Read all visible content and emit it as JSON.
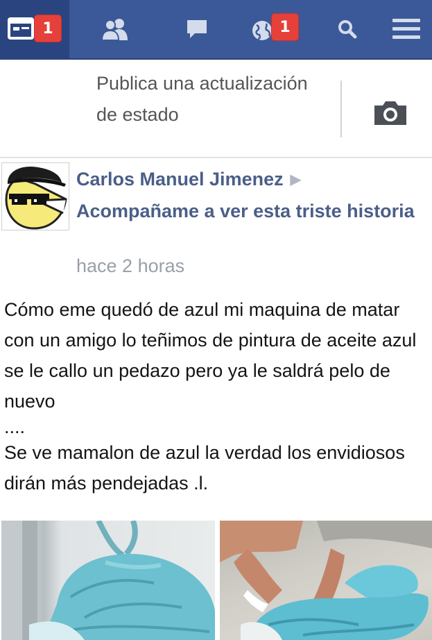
{
  "nav": {
    "feed_badge": "1",
    "globe_badge": "1",
    "items": [
      {
        "icon": "news-feed-icon"
      },
      {
        "icon": "friends-icon"
      },
      {
        "icon": "messages-icon"
      },
      {
        "icon": "notifications-globe-icon"
      },
      {
        "icon": "search-icon"
      },
      {
        "icon": "menu-icon"
      }
    ]
  },
  "composer": {
    "placeholder": "Publica una actualización de estado",
    "camera_icon": "camera-icon"
  },
  "post": {
    "author": "Carlos Manuel Jimenez",
    "target": "Acompañame a ver esta triste historia",
    "time": "hace 2 horas",
    "paragraph1": "Cómo eme quedó de azul mi maquina de matar con un amigo lo teñimos de pintura de aceite azul se le callo un pedazo pero ya le saldrá pelo de nuevo",
    "separator": "....",
    "paragraph2": "Se ve mamalon de azul la verdad los envidiosos dirán más pendejadas .l."
  },
  "colors": {
    "nav_bg": "#3b5998",
    "badge": "#e6403a",
    "author": "#4a5f88",
    "time": "#9aa0a8"
  }
}
